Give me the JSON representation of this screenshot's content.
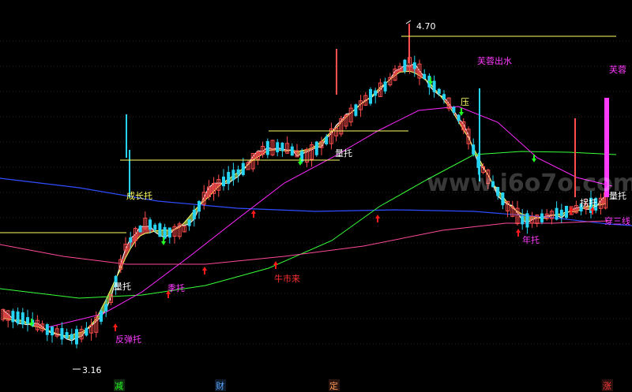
{
  "chart_data": {
    "type": "candlestick",
    "price_high_label": "4.70",
    "price_low_label": "3.16",
    "y_range": [
      3.12,
      4.82
    ],
    "colors": {
      "up": "#ff4d4d",
      "down": "#27d3f2",
      "ma_blue": "#2f4dff",
      "ma_green": "#39ff3a",
      "ma_magenta": "#ff2aff",
      "ma_red": "#ff4a9a",
      "band_up": "#b23a3a",
      "band_down": "#7f9a3b",
      "support": "#ffff66",
      "arrow_up": "#ff1a1a",
      "arrow_down": "#22ff22"
    },
    "signals": [
      {
        "text": "成长托",
        "color": "#ffff66"
      },
      {
        "text": "量托",
        "color": "#ffffff"
      },
      {
        "text": "反弹托",
        "color": "#ff3bff"
      },
      {
        "text": "季托",
        "color": "#ff3bff"
      },
      {
        "text": "牛市来",
        "color": "#ff3030"
      },
      {
        "text": "量托",
        "color": "#ffffff"
      },
      {
        "text": "芙蓉出水",
        "color": "#ff3bff"
      },
      {
        "text": "压",
        "color": "#ffff66"
      },
      {
        "text": "芙蓉",
        "color": "#ff3bff"
      },
      {
        "text": "量托",
        "color": "#ffffff"
      },
      {
        "text": "穿三线",
        "color": "#ff3bff"
      },
      {
        "text": "年托",
        "color": "#ff3bff"
      },
      {
        "text": "拐托",
        "color": "#ffffff"
      }
    ],
    "bottom_labels": [
      {
        "text": "减",
        "color": "#22ff22",
        "bg": "#0f2a0f"
      },
      {
        "text": "财",
        "color": "#5aa8ff",
        "bg": "#0f1a2a"
      },
      {
        "text": "定",
        "color": "#ff9a5a",
        "bg": "#2a150f"
      },
      {
        "text": "涨",
        "color": "#ff3b3b",
        "bg": "#2a0f0f"
      }
    ],
    "watermark": "www.i6o7o.com"
  }
}
